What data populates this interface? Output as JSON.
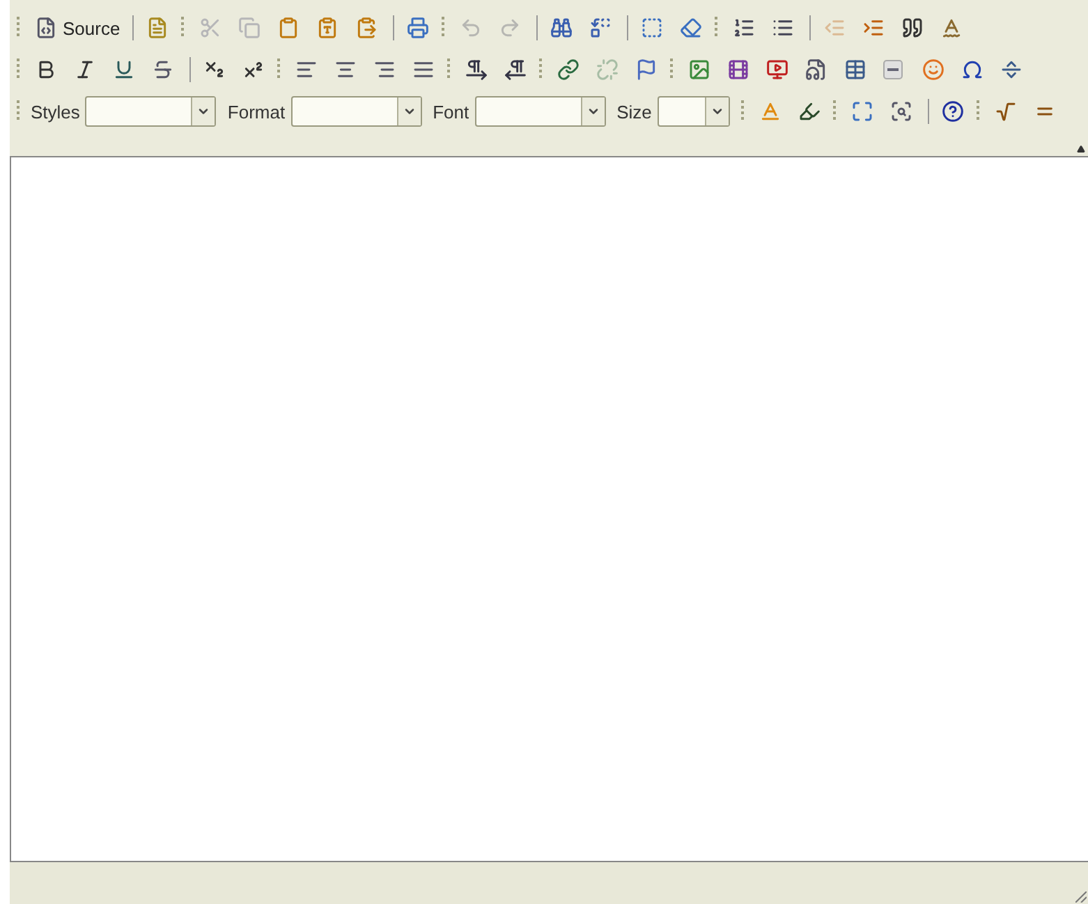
{
  "toolbar": {
    "rows": [
      [
        {
          "kind": "grip"
        },
        {
          "kind": "text-button",
          "label": "Source",
          "disabled": false
        },
        {
          "kind": "separator"
        },
        {
          "kind": "button",
          "disabled": false
        },
        {
          "kind": "grip"
        },
        {
          "kind": "button",
          "disabled": true
        },
        {
          "kind": "button",
          "disabled": true
        },
        {
          "kind": "button",
          "disabled": false
        },
        {
          "kind": "button",
          "disabled": false
        },
        {
          "kind": "button",
          "disabled": false
        },
        {
          "kind": "separator"
        },
        {
          "kind": "button",
          "disabled": false
        },
        {
          "kind": "grip"
        },
        {
          "kind": "button",
          "disabled": true
        },
        {
          "kind": "button",
          "disabled": true
        },
        {
          "kind": "separator"
        },
        {
          "kind": "button",
          "disabled": false
        },
        {
          "kind": "button",
          "disabled": false
        },
        {
          "kind": "separator"
        },
        {
          "kind": "button",
          "disabled": false
        },
        {
          "kind": "button",
          "disabled": false
        },
        {
          "kind": "grip"
        },
        {
          "kind": "button",
          "disabled": false
        },
        {
          "kind": "button",
          "disabled": false
        },
        {
          "kind": "separator"
        },
        {
          "kind": "button",
          "disabled": true
        },
        {
          "kind": "button",
          "disabled": false
        },
        {
          "kind": "button",
          "disabled": false
        },
        {
          "kind": "button",
          "disabled": false
        }
      ],
      [
        {
          "kind": "grip"
        },
        {
          "kind": "button",
          "disabled": false
        },
        {
          "kind": "button",
          "disabled": false
        },
        {
          "kind": "button",
          "disabled": false
        },
        {
          "kind": "button",
          "disabled": false
        },
        {
          "kind": "separator"
        },
        {
          "kind": "button",
          "disabled": false
        },
        {
          "kind": "button",
          "disabled": false
        },
        {
          "kind": "grip"
        },
        {
          "kind": "button",
          "disabled": false
        },
        {
          "kind": "button",
          "disabled": false
        },
        {
          "kind": "button",
          "disabled": false
        },
        {
          "kind": "button",
          "disabled": false
        },
        {
          "kind": "grip"
        },
        {
          "kind": "button",
          "disabled": false
        },
        {
          "kind": "button",
          "disabled": false
        },
        {
          "kind": "grip"
        },
        {
          "kind": "button",
          "disabled": false
        },
        {
          "kind": "button",
          "disabled": true
        },
        {
          "kind": "button",
          "disabled": false
        },
        {
          "kind": "grip"
        },
        {
          "kind": "button",
          "disabled": false
        },
        {
          "kind": "button",
          "disabled": false
        },
        {
          "kind": "button",
          "disabled": false
        },
        {
          "kind": "button",
          "disabled": false
        },
        {
          "kind": "button",
          "disabled": false
        },
        {
          "kind": "button",
          "disabled": false
        },
        {
          "kind": "button",
          "disabled": false
        },
        {
          "kind": "button",
          "disabled": false
        },
        {
          "kind": "button",
          "disabled": false
        }
      ],
      [
        {
          "kind": "grip"
        },
        {
          "kind": "combo",
          "label": "Styles"
        },
        {
          "kind": "combo",
          "label": "Format"
        },
        {
          "kind": "combo",
          "label": "Font"
        },
        {
          "kind": "combo",
          "label": "Size"
        },
        {
          "kind": "grip"
        },
        {
          "kind": "button",
          "disabled": false
        },
        {
          "kind": "button",
          "disabled": false
        },
        {
          "kind": "grip"
        },
        {
          "kind": "button",
          "disabled": false
        },
        {
          "kind": "button",
          "disabled": false
        },
        {
          "kind": "separator"
        },
        {
          "kind": "button",
          "disabled": false
        },
        {
          "kind": "grip"
        },
        {
          "kind": "button",
          "disabled": false
        },
        {
          "kind": "button",
          "disabled": false
        }
      ]
    ]
  }
}
